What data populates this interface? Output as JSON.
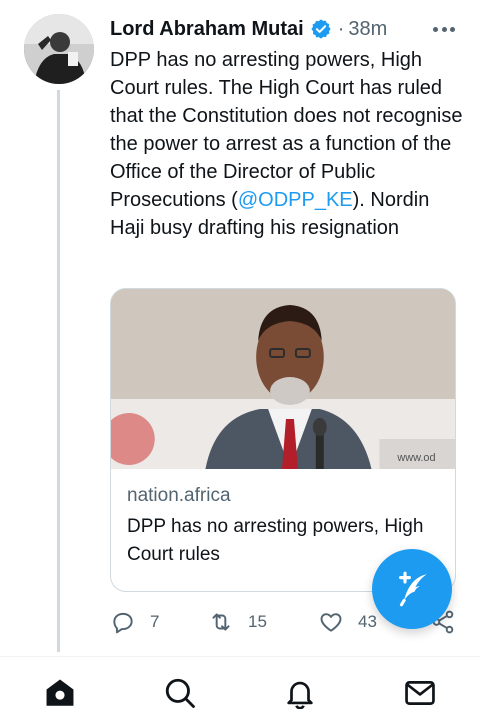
{
  "tweet": {
    "author_name": "Lord Abraham Mutai",
    "separator": "·",
    "time": "38m",
    "text_before_mention": "DPP has no arresting powers, High Court rules. The High Court has ruled that the Constitution does not recognise the power to arrest as a function of the Office of the Director of Public Prosecutions (",
    "mention": "@ODPP_KE",
    "text_after_mention": "). Nordin Haji busy drafting his resignation"
  },
  "card": {
    "domain": "nation.africa",
    "title": "DPP has no arresting powers, High Court rules"
  },
  "actions": {
    "reply_count": "7",
    "retweet_count": "15",
    "like_count": "43"
  },
  "icons": {
    "verified": "verified-badge-icon",
    "more": "more-icon",
    "reply": "reply-icon",
    "retweet": "retweet-icon",
    "like": "heart-icon",
    "share": "share-icon",
    "compose": "compose-icon",
    "home": "home-icon",
    "search": "search-icon",
    "notifications": "bell-icon",
    "messages": "mail-icon"
  },
  "colors": {
    "accent": "#1d9bf0",
    "text": "#0f1419",
    "secondary": "#536471",
    "border": "#cfd9de"
  }
}
